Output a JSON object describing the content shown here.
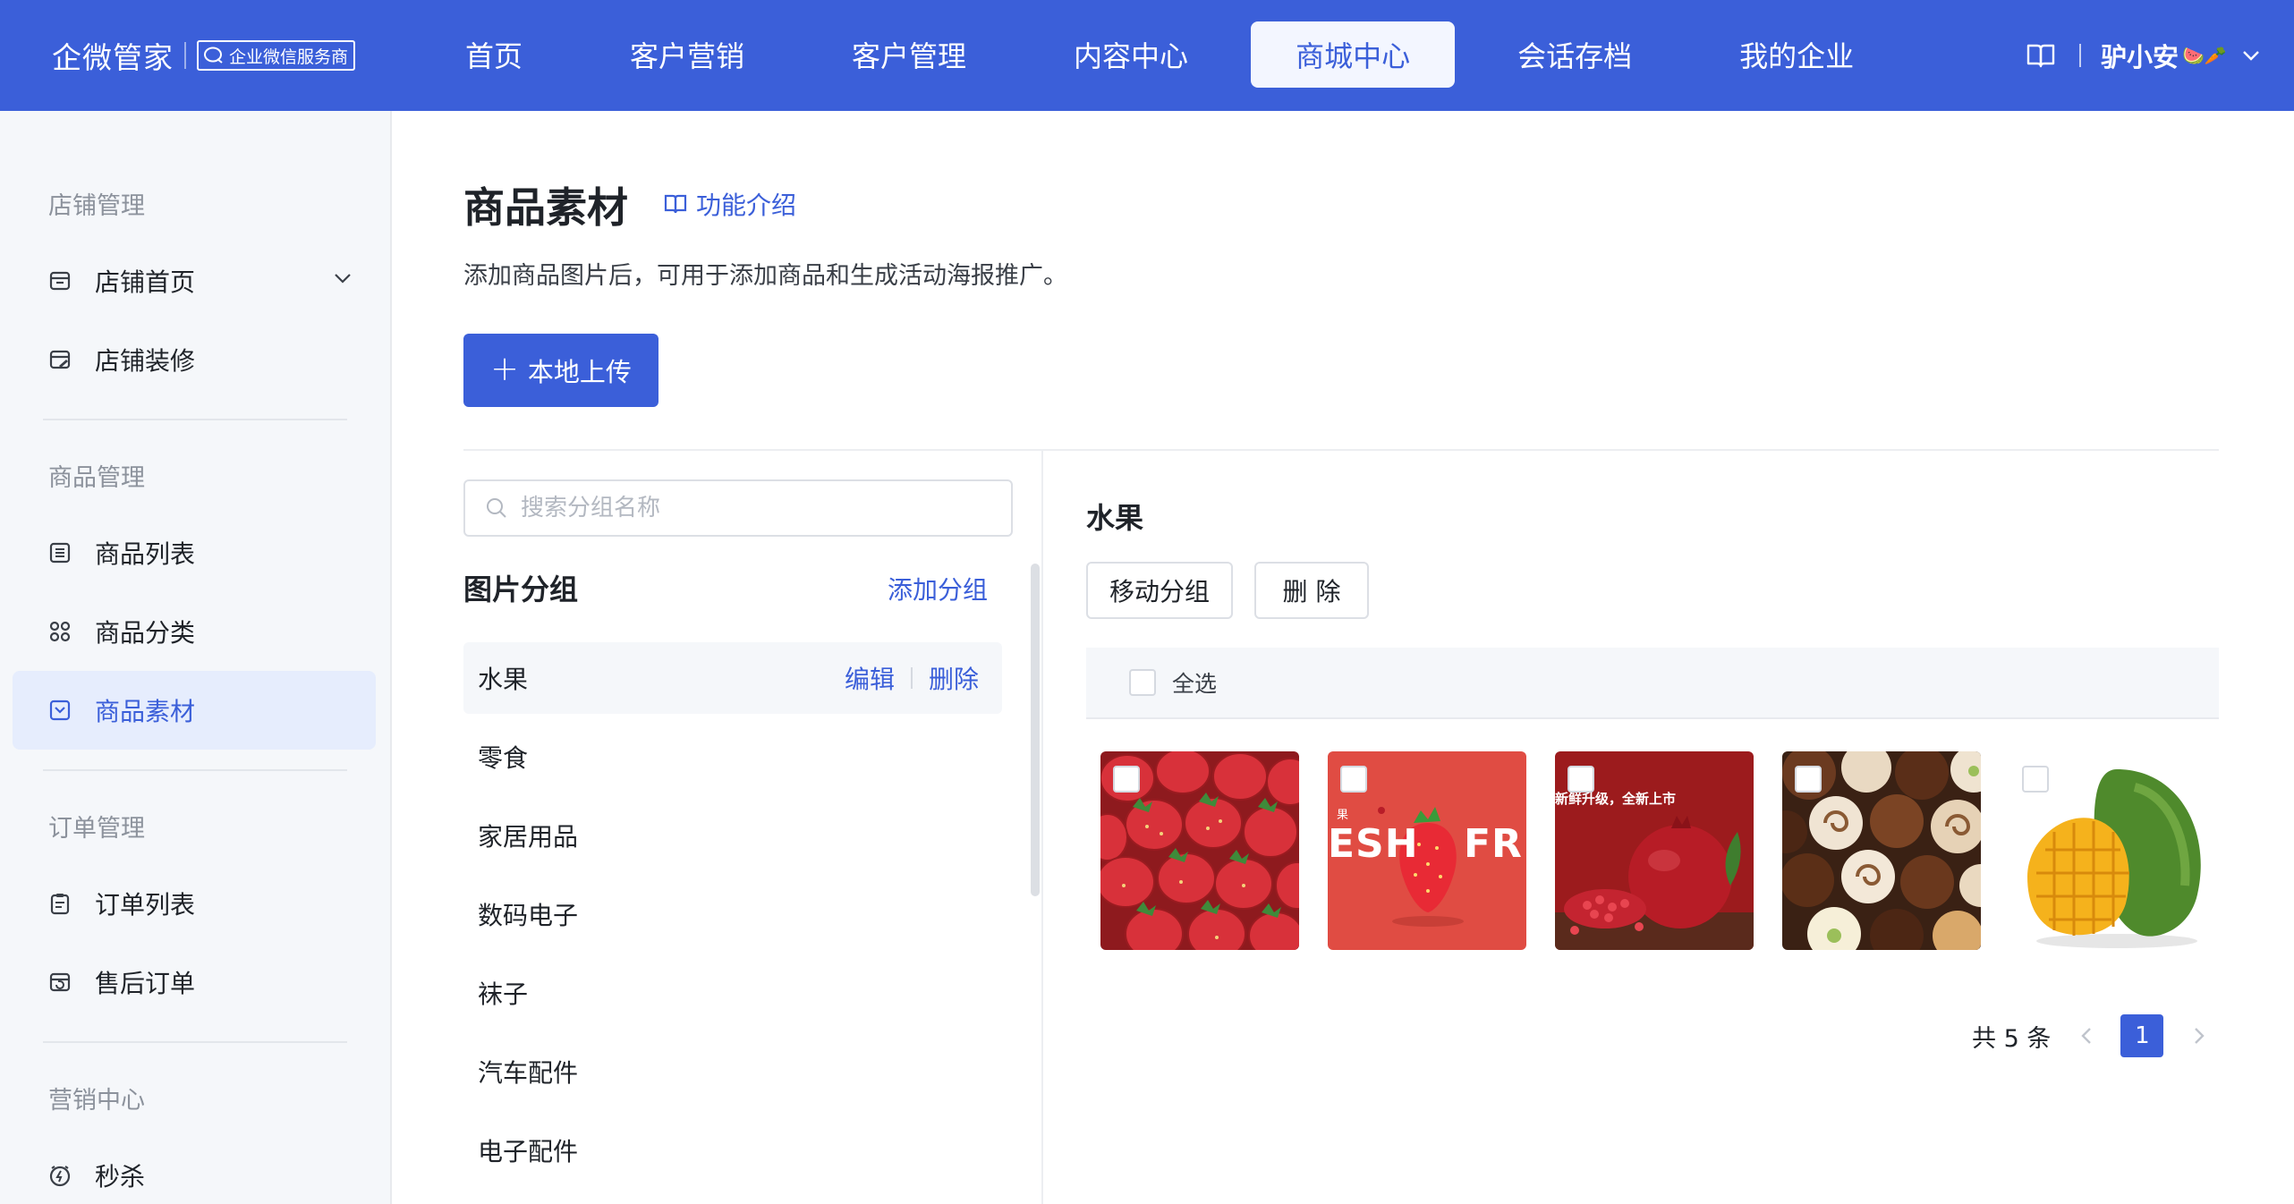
{
  "topbar": {
    "brand": "企微管家",
    "badge": "企业微信服务商",
    "nav": [
      "首页",
      "客户营销",
      "客户管理",
      "内容中心",
      "商城中心",
      "会话存档",
      "我的企业"
    ],
    "active_nav": "商城中心",
    "user": "驴小安",
    "user_emoji": "🍉🥕"
  },
  "sidebar": {
    "sections": [
      {
        "title": "店铺管理",
        "items": [
          "店铺首页",
          "店铺装修"
        ]
      },
      {
        "title": "商品管理",
        "items": [
          "商品列表",
          "商品分类",
          "商品素材"
        ]
      },
      {
        "title": "订单管理",
        "items": [
          "订单列表",
          "售后订单"
        ]
      },
      {
        "title": "营销中心",
        "items": [
          "秒杀"
        ]
      }
    ],
    "active_item": "商品素材"
  },
  "main": {
    "title": "商品素材",
    "intro_link": "功能介绍",
    "description": "添加商品图片后，可用于添加商品和生成活动海报推广。",
    "upload_button": "本地上传",
    "groups": {
      "search_placeholder": "搜索分组名称",
      "title": "图片分组",
      "add_label": "添加分组",
      "items": [
        "水果",
        "零食",
        "家居用品",
        "数码电子",
        "袜子",
        "汽车配件",
        "电子配件"
      ],
      "edit_label": "编辑",
      "delete_label": "删除"
    },
    "images": {
      "category": "水果",
      "move_button": "移动分组",
      "delete_button": "删 除",
      "select_all": "全选",
      "thumbnails": [
        {
          "name": "strawberries"
        },
        {
          "name": "fresh-fruit-strawberry",
          "text_left": "ESH",
          "text_right": "FRU",
          "text_small": "果"
        },
        {
          "name": "pomegranate",
          "text": "新鲜升级，全新上市"
        },
        {
          "name": "chocolates"
        },
        {
          "name": "mango"
        }
      ],
      "total": "共 5 条",
      "current_page": "1"
    }
  },
  "colors": {
    "primary": "#3b5fd9",
    "sidebar_bg": "#f5f7fa",
    "active_bg": "#e6edfd"
  }
}
